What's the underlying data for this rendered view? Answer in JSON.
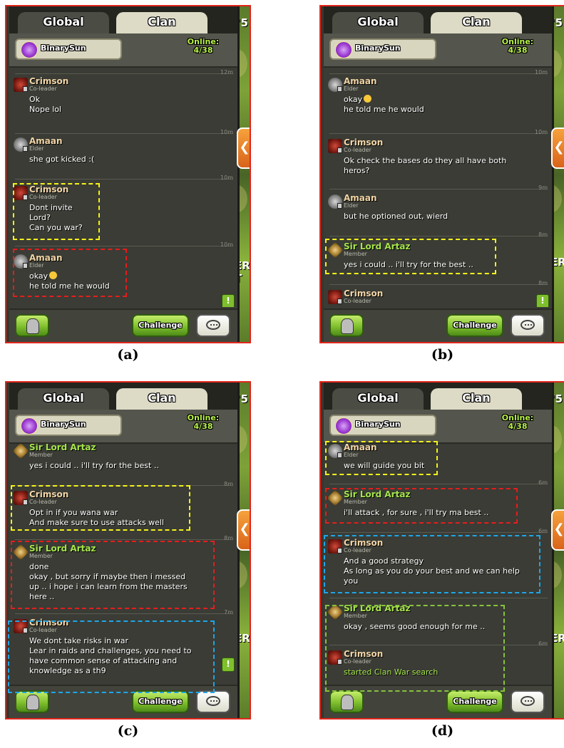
{
  "panels": [
    {
      "caption": "(a)",
      "tab_global": "Global",
      "tab_clan": "Clan",
      "clan_name": "BinarySun",
      "online_label": "Online:",
      "online_count": "4/38",
      "time_top": "12m",
      "messages": [
        {
          "name": "Crimson",
          "role": "Co-leader",
          "lines": [
            "Ok",
            "Nope lol"
          ],
          "time": "10m"
        },
        {
          "name": "Amaan",
          "role": "Elder",
          "lines": [
            "she got kicked :("
          ],
          "time": "10m"
        },
        {
          "name": "Crimson",
          "role": "Co-leader",
          "lines": [
            "Dont invite",
            "Lord?",
            "Can you war?"
          ],
          "time": "10m"
        },
        {
          "name": "Amaan",
          "role": "Elder",
          "lines": [
            "okay",
            "he told me he would"
          ],
          "time": ""
        }
      ],
      "challenge": "Challenge",
      "bg_text": "ER T"
    },
    {
      "caption": "(b)",
      "tab_global": "Global",
      "tab_clan": "Clan",
      "clan_name": "BinarySun",
      "online_label": "Online:",
      "online_count": "4/38",
      "time_top": "10m",
      "messages": [
        {
          "name": "Amaan",
          "role": "Elder",
          "lines": [
            "okay",
            "he told me he would"
          ],
          "time": "10m"
        },
        {
          "name": "Crimson",
          "role": "Co-leader",
          "lines": [
            "Ok check the bases do they all have both",
            "heros?"
          ],
          "time": "9m"
        },
        {
          "name": "Amaan",
          "role": "Elder",
          "lines": [
            "but he optioned out, wierd"
          ],
          "time": "8m"
        },
        {
          "name": "Sir Lord Artaz",
          "role": "Member",
          "lines": [
            "yes i could .. i'll try for the best .."
          ],
          "time": "8m"
        },
        {
          "name": "Crimson",
          "role": "Co-leader",
          "lines": [],
          "time": ""
        }
      ],
      "challenge": "Challenge",
      "bg_text": "ER"
    },
    {
      "caption": "(c)",
      "tab_global": "Global",
      "tab_clan": "Clan",
      "clan_name": "BinarySun",
      "online_label": "Online:",
      "online_count": "4/38",
      "messages": [
        {
          "name": "Sir Lord Artaz",
          "role": "Member",
          "lines": [
            "yes i could .. i'll try for the best .."
          ],
          "time": "8m"
        },
        {
          "name": "Crimson",
          "role": "Co-leader",
          "lines": [
            "Opt in if you wana war",
            "And make sure to use attacks well"
          ],
          "time": "8m"
        },
        {
          "name": "Sir Lord Artaz",
          "role": "Member",
          "lines": [
            "done",
            "okay , but sorry if maybe then i messed",
            "up .. i hope i can learn from the masters",
            "here .."
          ],
          "time": "7m"
        },
        {
          "name": "Crimson",
          "role": "Co-leader",
          "lines": [
            "We dont take risks in war",
            "Lear in raids and challenges, you need to",
            "have common sense of attacking and",
            "knowledge as a th9"
          ],
          "time": ""
        }
      ],
      "challenge": "Challenge",
      "bg_text": "ER"
    },
    {
      "caption": "(d)",
      "tab_global": "Global",
      "tab_clan": "Clan",
      "clan_name": "BinarySun",
      "online_label": "Online:",
      "online_count": "4/38",
      "messages": [
        {
          "name": "Amaan",
          "role": "Elder",
          "lines": [
            "we will guide you bit"
          ],
          "time": "6m"
        },
        {
          "name": "Sir Lord Artaz",
          "role": "Member",
          "lines": [
            "i'll attack , for sure , i'll try ma best .."
          ],
          "time": "6m"
        },
        {
          "name": "Crimson",
          "role": "Co-leader",
          "lines": [
            "And a good strategy",
            "As long as you do your best and we can help",
            "you"
          ],
          "time": ""
        },
        {
          "name": "Sir Lord Artaz",
          "role": "Member",
          "lines": [
            "okay , seems good enough for me .."
          ],
          "time": "6m"
        },
        {
          "name": "Crimson",
          "role": "Co-leader",
          "lines": [
            "started Clan War search"
          ],
          "time": ""
        }
      ],
      "challenge": "Challenge",
      "bg_text": "ER"
    }
  ],
  "colors": {
    "yellow": "#f6f21a",
    "red": "#e51d1d",
    "blue": "#1ea6e8",
    "green": "#87c23d",
    "frame": "#e1261c"
  }
}
